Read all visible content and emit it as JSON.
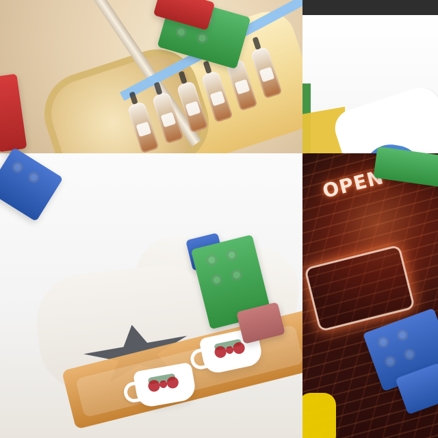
{
  "neon_sign": {
    "text": "OPEN"
  }
}
